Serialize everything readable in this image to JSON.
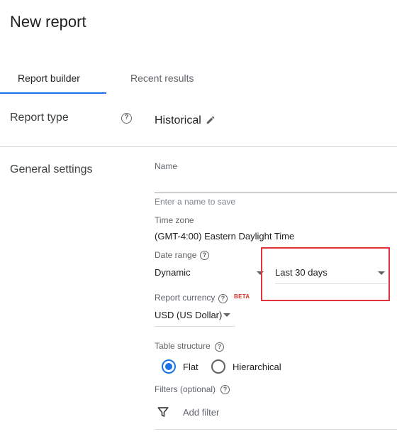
{
  "page": {
    "title": "New report"
  },
  "tabs": [
    {
      "label": "Report builder",
      "active": true
    },
    {
      "label": "Recent results",
      "active": false
    }
  ],
  "report_type": {
    "label": "Report type",
    "value": "Historical"
  },
  "general_settings": {
    "label": "General settings",
    "name": {
      "label": "Name",
      "value": "",
      "hint": "Enter a name to save"
    },
    "time_zone": {
      "label": "Time zone",
      "value": "(GMT-4:00) Eastern Daylight Time"
    },
    "date_range": {
      "label": "Date range",
      "type_value": "Dynamic",
      "range_value": "Last 30 days"
    },
    "report_currency": {
      "label": "Report currency",
      "badge": "BETA",
      "value": "USD (US Dollar)"
    },
    "table_structure": {
      "label": "Table structure",
      "options": [
        {
          "label": "Flat",
          "selected": true
        },
        {
          "label": "Hierarchical",
          "selected": false
        }
      ]
    },
    "filters": {
      "label": "Filters (optional)",
      "add_label": "Add filter"
    }
  },
  "colors": {
    "accent": "#1a73e8",
    "highlight_box": "#e0343f",
    "beta_badge": "#d93025"
  },
  "icons": [
    "help-icon",
    "edit-pencil-icon",
    "dropdown-caret-icon",
    "filter-icon"
  ]
}
